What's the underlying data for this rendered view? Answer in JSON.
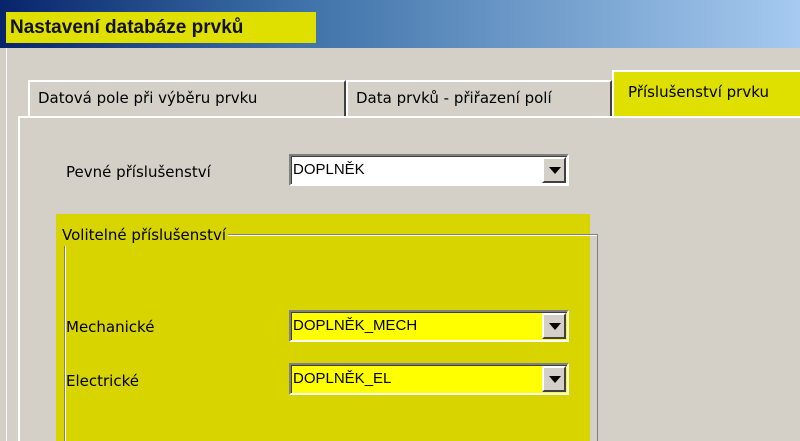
{
  "window": {
    "title": "Nastavení databáze prvků"
  },
  "tabs": [
    {
      "label": "Datová pole při výběru prvku",
      "active": false
    },
    {
      "label": "Data prvků - přiřazení polí",
      "active": false
    },
    {
      "label": "Příslušenství prvku",
      "active": true
    }
  ],
  "fixed": {
    "label": "Pevné příslušenství",
    "value": "DOPLNĚK"
  },
  "optional_group": {
    "legend": "Volitelné příslušenství",
    "mechanical": {
      "label": "Mechanické",
      "value": "DOPLNĚK_MECH"
    },
    "electrical": {
      "label": "Electrické",
      "value": "DOPLNĚK_EL"
    }
  },
  "colors": {
    "highlight": "#e0e000",
    "group_highlight": "#d8d400",
    "combo_highlight": "#ffff00",
    "dialog_face": "#d4d0c8"
  }
}
